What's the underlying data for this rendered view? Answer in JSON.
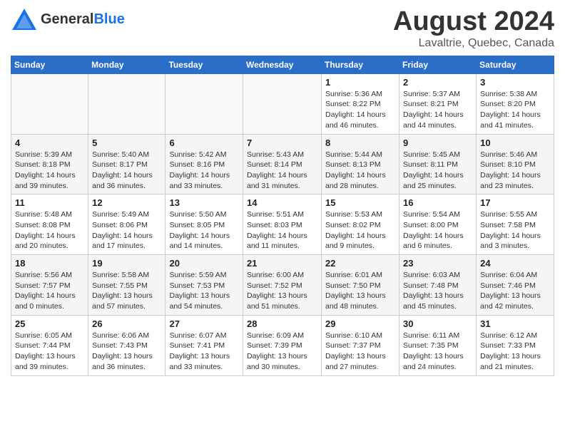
{
  "header": {
    "logo_general": "General",
    "logo_blue": "Blue",
    "month_title": "August 2024",
    "location": "Lavaltrie, Quebec, Canada"
  },
  "calendar": {
    "days_of_week": [
      "Sunday",
      "Monday",
      "Tuesday",
      "Wednesday",
      "Thursday",
      "Friday",
      "Saturday"
    ],
    "weeks": [
      {
        "days": [
          {
            "number": "",
            "info": ""
          },
          {
            "number": "",
            "info": ""
          },
          {
            "number": "",
            "info": ""
          },
          {
            "number": "",
            "info": ""
          },
          {
            "number": "1",
            "info": "Sunrise: 5:36 AM\nSunset: 8:22 PM\nDaylight: 14 hours\nand 46 minutes."
          },
          {
            "number": "2",
            "info": "Sunrise: 5:37 AM\nSunset: 8:21 PM\nDaylight: 14 hours\nand 44 minutes."
          },
          {
            "number": "3",
            "info": "Sunrise: 5:38 AM\nSunset: 8:20 PM\nDaylight: 14 hours\nand 41 minutes."
          }
        ]
      },
      {
        "days": [
          {
            "number": "4",
            "info": "Sunrise: 5:39 AM\nSunset: 8:18 PM\nDaylight: 14 hours\nand 39 minutes."
          },
          {
            "number": "5",
            "info": "Sunrise: 5:40 AM\nSunset: 8:17 PM\nDaylight: 14 hours\nand 36 minutes."
          },
          {
            "number": "6",
            "info": "Sunrise: 5:42 AM\nSunset: 8:16 PM\nDaylight: 14 hours\nand 33 minutes."
          },
          {
            "number": "7",
            "info": "Sunrise: 5:43 AM\nSunset: 8:14 PM\nDaylight: 14 hours\nand 31 minutes."
          },
          {
            "number": "8",
            "info": "Sunrise: 5:44 AM\nSunset: 8:13 PM\nDaylight: 14 hours\nand 28 minutes."
          },
          {
            "number": "9",
            "info": "Sunrise: 5:45 AM\nSunset: 8:11 PM\nDaylight: 14 hours\nand 25 minutes."
          },
          {
            "number": "10",
            "info": "Sunrise: 5:46 AM\nSunset: 8:10 PM\nDaylight: 14 hours\nand 23 minutes."
          }
        ]
      },
      {
        "days": [
          {
            "number": "11",
            "info": "Sunrise: 5:48 AM\nSunset: 8:08 PM\nDaylight: 14 hours\nand 20 minutes."
          },
          {
            "number": "12",
            "info": "Sunrise: 5:49 AM\nSunset: 8:06 PM\nDaylight: 14 hours\nand 17 minutes."
          },
          {
            "number": "13",
            "info": "Sunrise: 5:50 AM\nSunset: 8:05 PM\nDaylight: 14 hours\nand 14 minutes."
          },
          {
            "number": "14",
            "info": "Sunrise: 5:51 AM\nSunset: 8:03 PM\nDaylight: 14 hours\nand 11 minutes."
          },
          {
            "number": "15",
            "info": "Sunrise: 5:53 AM\nSunset: 8:02 PM\nDaylight: 14 hours\nand 9 minutes."
          },
          {
            "number": "16",
            "info": "Sunrise: 5:54 AM\nSunset: 8:00 PM\nDaylight: 14 hours\nand 6 minutes."
          },
          {
            "number": "17",
            "info": "Sunrise: 5:55 AM\nSunset: 7:58 PM\nDaylight: 14 hours\nand 3 minutes."
          }
        ]
      },
      {
        "days": [
          {
            "number": "18",
            "info": "Sunrise: 5:56 AM\nSunset: 7:57 PM\nDaylight: 14 hours\nand 0 minutes."
          },
          {
            "number": "19",
            "info": "Sunrise: 5:58 AM\nSunset: 7:55 PM\nDaylight: 13 hours\nand 57 minutes."
          },
          {
            "number": "20",
            "info": "Sunrise: 5:59 AM\nSunset: 7:53 PM\nDaylight: 13 hours\nand 54 minutes."
          },
          {
            "number": "21",
            "info": "Sunrise: 6:00 AM\nSunset: 7:52 PM\nDaylight: 13 hours\nand 51 minutes."
          },
          {
            "number": "22",
            "info": "Sunrise: 6:01 AM\nSunset: 7:50 PM\nDaylight: 13 hours\nand 48 minutes."
          },
          {
            "number": "23",
            "info": "Sunrise: 6:03 AM\nSunset: 7:48 PM\nDaylight: 13 hours\nand 45 minutes."
          },
          {
            "number": "24",
            "info": "Sunrise: 6:04 AM\nSunset: 7:46 PM\nDaylight: 13 hours\nand 42 minutes."
          }
        ]
      },
      {
        "days": [
          {
            "number": "25",
            "info": "Sunrise: 6:05 AM\nSunset: 7:44 PM\nDaylight: 13 hours\nand 39 minutes."
          },
          {
            "number": "26",
            "info": "Sunrise: 6:06 AM\nSunset: 7:43 PM\nDaylight: 13 hours\nand 36 minutes."
          },
          {
            "number": "27",
            "info": "Sunrise: 6:07 AM\nSunset: 7:41 PM\nDaylight: 13 hours\nand 33 minutes."
          },
          {
            "number": "28",
            "info": "Sunrise: 6:09 AM\nSunset: 7:39 PM\nDaylight: 13 hours\nand 30 minutes."
          },
          {
            "number": "29",
            "info": "Sunrise: 6:10 AM\nSunset: 7:37 PM\nDaylight: 13 hours\nand 27 minutes."
          },
          {
            "number": "30",
            "info": "Sunrise: 6:11 AM\nSunset: 7:35 PM\nDaylight: 13 hours\nand 24 minutes."
          },
          {
            "number": "31",
            "info": "Sunrise: 6:12 AM\nSunset: 7:33 PM\nDaylight: 13 hours\nand 21 minutes."
          }
        ]
      }
    ]
  }
}
